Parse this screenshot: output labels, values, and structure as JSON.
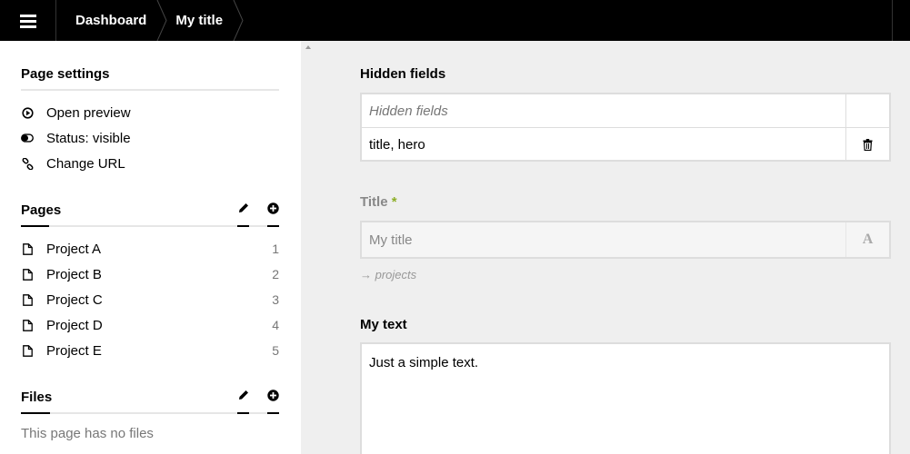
{
  "topbar": {
    "menu_icon": "hamburger-icon",
    "breadcrumbs": [
      {
        "label": "Dashboard"
      },
      {
        "label": "My title"
      }
    ]
  },
  "sidebar": {
    "page_settings": {
      "title": "Page settings",
      "items": [
        {
          "label": "Open preview",
          "icon": "play-circle-icon"
        },
        {
          "label": "Status: visible",
          "icon": "toggle-on-icon"
        },
        {
          "label": "Change URL",
          "icon": "chain-link-icon"
        }
      ]
    },
    "pages": {
      "title": "Pages",
      "edit_icon": "pencil-icon",
      "add_icon": "plus-circle-icon",
      "items": [
        {
          "label": "Project A",
          "num": "1"
        },
        {
          "label": "Project B",
          "num": "2"
        },
        {
          "label": "Project C",
          "num": "3"
        },
        {
          "label": "Project D",
          "num": "4"
        },
        {
          "label": "Project E",
          "num": "5"
        }
      ]
    },
    "files": {
      "title": "Files",
      "edit_icon": "pencil-icon",
      "add_icon": "plus-circle-icon",
      "empty_text": "This page has no files"
    }
  },
  "main": {
    "hidden_fields": {
      "label": "Hidden fields",
      "column_header": "Hidden fields",
      "rows": [
        {
          "value": "title, hero",
          "action_icon": "trash-icon"
        }
      ]
    },
    "title_field": {
      "label": "Title",
      "required_mark": "*",
      "value": "My title",
      "icon_glyph": "A",
      "url_arrow": "→",
      "url_hint": "projects"
    },
    "text_field": {
      "label": "My text",
      "value": "Just a simple text."
    }
  },
  "colors": {
    "topbar_bg": "#000000",
    "main_bg": "#efefef",
    "required_accent": "#8dae28"
  }
}
